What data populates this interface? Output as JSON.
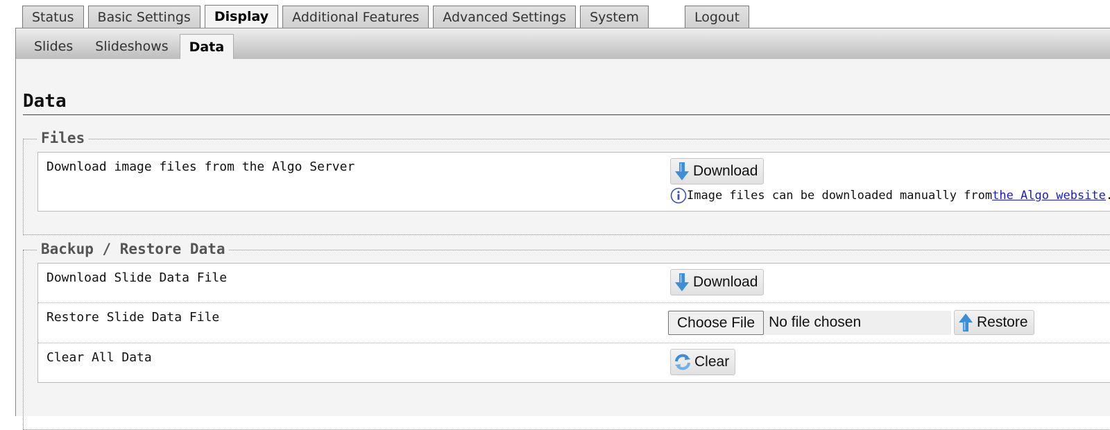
{
  "main_tabs": [
    "Status",
    "Basic Settings",
    "Display",
    "Additional Features",
    "Advanced Settings",
    "System"
  ],
  "main_active": "Display",
  "logout_label": "Logout",
  "sub_tabs": [
    "Slides",
    "Slideshows",
    "Data"
  ],
  "sub_active": "Data",
  "page_title": "Data",
  "files": {
    "legend": "Files",
    "download_row": {
      "label": "Download image files from the Algo Server",
      "button": "Download",
      "info_text": "Image files can be downloaded manually from ",
      "info_link": "the Algo website",
      "info_suffix": "."
    }
  },
  "backup": {
    "legend": "Backup / Restore Data",
    "download_row": {
      "label": "Download Slide Data File",
      "button": "Download"
    },
    "restore_row": {
      "label": "Restore Slide Data File",
      "choose_button": "Choose File",
      "file_status": "No file chosen",
      "restore_button": "Restore"
    },
    "clear_row": {
      "label": "Clear All Data",
      "button": "Clear"
    }
  },
  "colors": {
    "link": "#1a1ad0",
    "icon_blue": "#3a8fd8",
    "info_blue": "#3b4fc4"
  },
  "icons": {
    "download": "download-arrow-icon",
    "restore": "upload-arrow-icon",
    "clear": "refresh-icon",
    "info": "info-icon"
  }
}
